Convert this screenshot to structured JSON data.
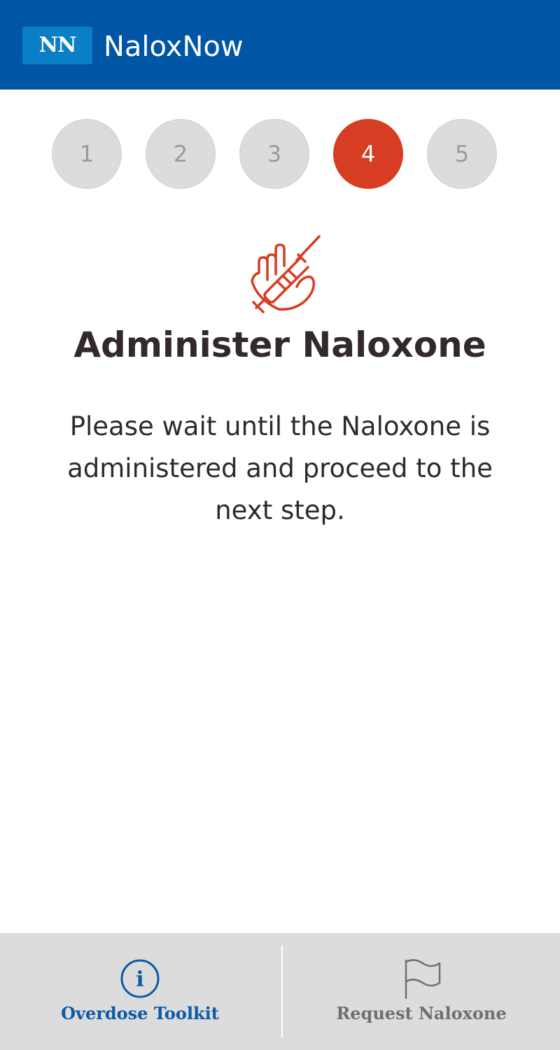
{
  "header": {
    "logo_text": "NN",
    "app_title": "NaloxNow",
    "background_color": "#0055a5"
  },
  "steps": {
    "items": [
      "1",
      "2",
      "3",
      "4",
      "5"
    ],
    "active_step": "4",
    "active_color": "#d63d22",
    "inactive_color": "#dcdcdc"
  },
  "content": {
    "icon": "hand-syringe-icon",
    "title": "Administer Naloxone",
    "description": "Please wait until the Naloxone is administered and proceed to the next step."
  },
  "bottom_nav": {
    "tabs": [
      {
        "label": "Overdose Toolkit",
        "icon": "info-icon",
        "active": true
      },
      {
        "label": "Request Naloxone",
        "icon": "flag-icon",
        "active": false
      }
    ],
    "active_color": "#0c5aa8",
    "inactive_color": "#6f6f6f"
  }
}
